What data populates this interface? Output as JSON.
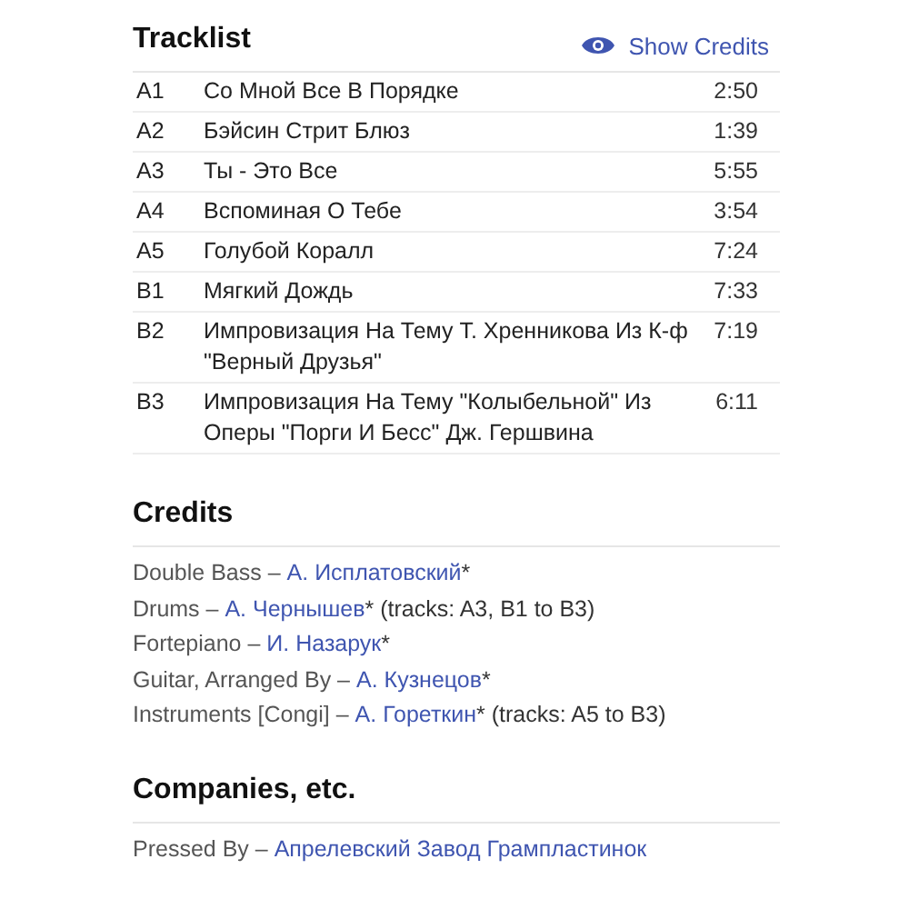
{
  "tracklist": {
    "title": "Tracklist",
    "show_credits": "Show Credits",
    "tracks": [
      {
        "position": "A1",
        "title": "Со Мной Все В Порядке",
        "duration": "2:50"
      },
      {
        "position": "A2",
        "title": "Бэйсин Стрит Блюз",
        "duration": "1:39"
      },
      {
        "position": "A3",
        "title": "Ты - Это Все",
        "duration": "5:55"
      },
      {
        "position": "A4",
        "title": "Вспоминая О Тебе",
        "duration": "3:54"
      },
      {
        "position": "A5",
        "title": "Голубой Коралл",
        "duration": "7:24"
      },
      {
        "position": "B1",
        "title": "Мягкий Дождь",
        "duration": "7:33"
      },
      {
        "position": "B2",
        "title": "Импровизация На Тему Т. Хренникова Из К-ф \"Верный Друзья\"",
        "duration": "7:19"
      },
      {
        "position": "B3",
        "title": "Импровизация На Тему \"Колыбельной\" Из Оперы \"Порги И Бесс\" Дж. Гершвина",
        "duration": "6:11"
      }
    ]
  },
  "credits": {
    "title": "Credits",
    "items": [
      {
        "role": "Double Bass –",
        "name": "А. Исплатовский",
        "note": "*"
      },
      {
        "role": "Drums –",
        "name": "А. Чернышев",
        "note": "* (tracks: A3, B1 to B3)"
      },
      {
        "role": "Fortepiano –",
        "name": "И. Назарук",
        "note": "*"
      },
      {
        "role": "Guitar, Arranged By –",
        "name": "А. Кузнецов",
        "note": "*"
      },
      {
        "role": "Instruments [Congi] –",
        "name": "А. Гореткин",
        "note": "* (tracks: A5 to B3)"
      }
    ]
  },
  "companies": {
    "title": "Companies, etc.",
    "items": [
      {
        "role": "Pressed By –",
        "name": "Апрелевский Завод Грампластинок"
      }
    ]
  }
}
